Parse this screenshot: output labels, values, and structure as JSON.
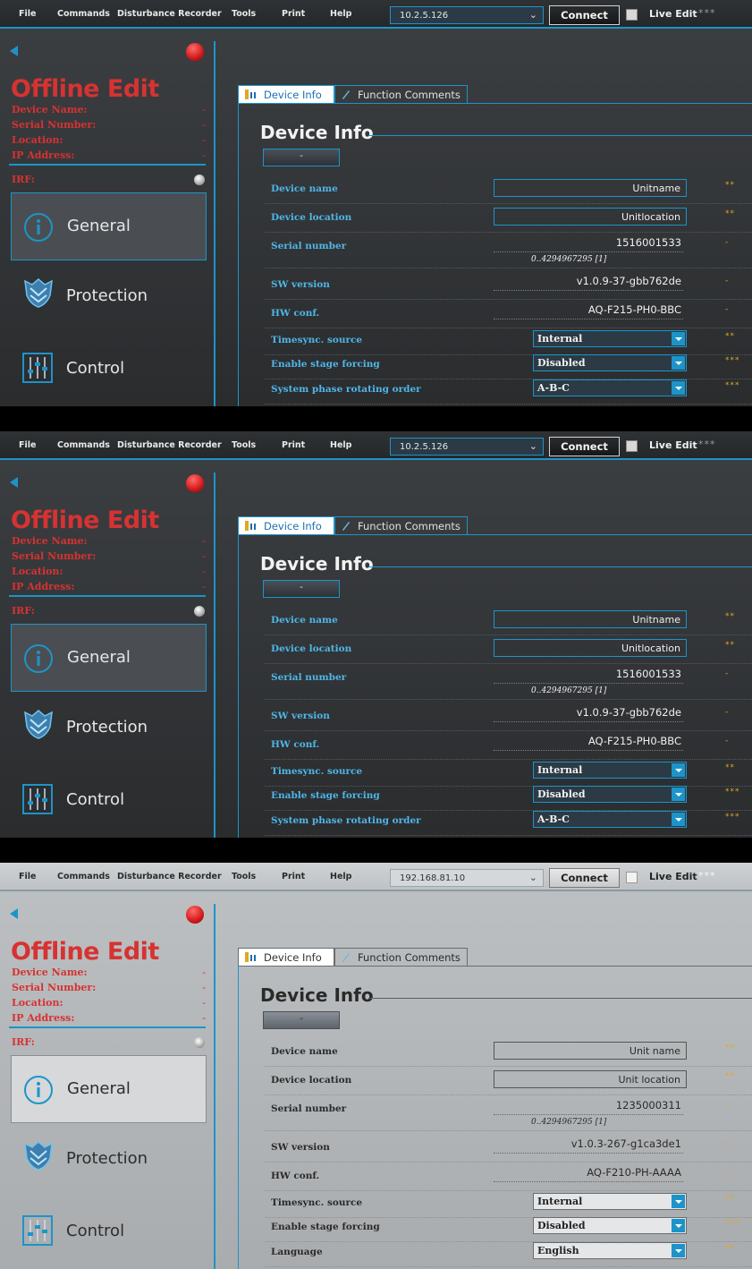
{
  "menu": [
    "File",
    "Commands",
    "Disturbance Recorder",
    "Tools",
    "Print",
    "Help"
  ],
  "screens": [
    {
      "theme": "dark",
      "ip": "10.2.5.126",
      "connect_label": "Connect",
      "live_edit_label": "Live Edit",
      "live_edit_stars": "***",
      "offline_title": "Offline Edit",
      "device_labels": [
        "Device Name:",
        "Serial Number:",
        "Location:",
        "IP Address:"
      ],
      "device_values": [
        "-",
        "-",
        "-",
        "-"
      ],
      "irf_label": "IRF:",
      "nav": [
        "General",
        "Protection",
        "Control"
      ],
      "tab_device_info": "Device Info",
      "tab_function_comments": "Function Comments",
      "group_title": "Device Info",
      "collapse_label": "-",
      "rows": [
        {
          "label": "Device name",
          "kind": "input",
          "value": "Unitname",
          "stars": "**"
        },
        {
          "label": "Device location",
          "kind": "input",
          "value": "Unitlocation",
          "stars": "**"
        },
        {
          "label": "Serial number",
          "kind": "text",
          "value": "1516001533",
          "range": "0..4294967295 [1]",
          "stars": "-"
        },
        {
          "label": "SW version",
          "kind": "text",
          "value": "v1.0.9-37-gbb762de",
          "stars": "-"
        },
        {
          "label": "HW conf.",
          "kind": "text",
          "value": "AQ-F215-PH0-BBC",
          "stars": "-"
        },
        {
          "label": "Timesync. source",
          "kind": "select",
          "value": "Internal",
          "stars": "**"
        },
        {
          "label": "Enable stage forcing",
          "kind": "select",
          "value": "Disabled",
          "stars": "***"
        },
        {
          "label": "System phase rotating order",
          "kind": "select",
          "value": "A-B-C",
          "stars": "***"
        }
      ]
    },
    {
      "theme": "dark",
      "ip": "10.2.5.126",
      "connect_label": "Connect",
      "live_edit_label": "Live Edit",
      "live_edit_stars": "***",
      "offline_title": "Offline Edit",
      "device_labels": [
        "Device Name:",
        "Serial Number:",
        "Location:",
        "IP Address:"
      ],
      "device_values": [
        "-",
        "-",
        "-",
        "-"
      ],
      "irf_label": "IRF:",
      "nav": [
        "General",
        "Protection",
        "Control"
      ],
      "tab_device_info": "Device Info",
      "tab_function_comments": "Function Comments",
      "group_title": "Device Info",
      "collapse_label": "-",
      "rows": [
        {
          "label": "Device name",
          "kind": "input",
          "value": "Unitname",
          "stars": "**"
        },
        {
          "label": "Device location",
          "kind": "input",
          "value": "Unitlocation",
          "stars": "**"
        },
        {
          "label": "Serial number",
          "kind": "text",
          "value": "1516001533",
          "range": "0..4294967295 [1]",
          "stars": "-"
        },
        {
          "label": "SW version",
          "kind": "text",
          "value": "v1.0.9-37-gbb762de",
          "stars": "-"
        },
        {
          "label": "HW conf.",
          "kind": "text",
          "value": "AQ-F215-PH0-BBC",
          "stars": "-"
        },
        {
          "label": "Timesync. source",
          "kind": "select",
          "value": "Internal",
          "stars": "**"
        },
        {
          "label": "Enable stage forcing",
          "kind": "select",
          "value": "Disabled",
          "stars": "***"
        },
        {
          "label": "System phase rotating order",
          "kind": "select",
          "value": "A-B-C",
          "stars": "***"
        }
      ]
    },
    {
      "theme": "light",
      "ip": "192.168.81.10",
      "connect_label": "Connect",
      "live_edit_label": "Live Edit",
      "live_edit_stars": "***",
      "offline_title": "Offline Edit",
      "device_labels": [
        "Device Name:",
        "Serial Number:",
        "Location:",
        "IP Address:"
      ],
      "device_values": [
        "-",
        "-",
        "-",
        "-"
      ],
      "irf_label": "IRF:",
      "nav": [
        "General",
        "Protection",
        "Control"
      ],
      "tab_device_info": "Device Info",
      "tab_function_comments": "Function Comments",
      "group_title": "Device Info",
      "collapse_label": "-",
      "rows": [
        {
          "label": "Device name",
          "kind": "input",
          "value": "Unit name",
          "stars": "**"
        },
        {
          "label": "Device location",
          "kind": "input",
          "value": "Unit location",
          "stars": "**"
        },
        {
          "label": "Serial number",
          "kind": "text",
          "value": "1235000311",
          "range": "0..4294967295 [1]",
          "stars": "-"
        },
        {
          "label": "SW version",
          "kind": "text",
          "value": "v1.0.3-267-g1ca3de1",
          "stars": "-"
        },
        {
          "label": "HW conf.",
          "kind": "text",
          "value": "AQ-F210-PH-AAAA",
          "stars": "-"
        },
        {
          "label": "Timesync. source",
          "kind": "select",
          "value": "Internal",
          "stars": "**"
        },
        {
          "label": "Enable stage forcing",
          "kind": "select",
          "value": "Disabled",
          "stars": "***"
        },
        {
          "label": "Language",
          "kind": "select",
          "value": "English",
          "stars": "**"
        }
      ]
    }
  ]
}
